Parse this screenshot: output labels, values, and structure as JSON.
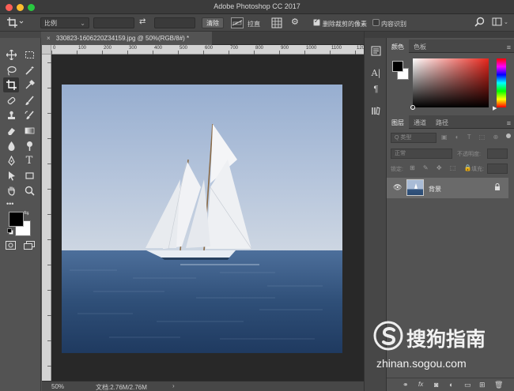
{
  "window": {
    "title": "Adobe Photoshop CC 2017"
  },
  "options_bar": {
    "ratio_label": "比例",
    "clear_label": "清除",
    "straighten_label": "拉直",
    "delete_cropped_label": "删除裁剪的像素",
    "content_aware_label": "内容识别",
    "delete_cropped_checked": true,
    "content_aware_checked": false
  },
  "document": {
    "tab_title": "330823-1606220Z34159.jpg @ 50%(RGB/8#) *",
    "ruler_marks": [
      "0",
      "100",
      "200",
      "300",
      "400",
      "500",
      "600",
      "700",
      "800",
      "900",
      "1000",
      "1100",
      "1200"
    ],
    "zoom": "50%",
    "doc_size": "文档:2.76M/2.76M"
  },
  "color_panel": {
    "tabs": [
      "颜色",
      "色板"
    ],
    "foreground": "#000000",
    "background": "#ffffff",
    "hue_color": "#e8261c"
  },
  "layers_panel": {
    "tabs": [
      "图层",
      "通道",
      "路径"
    ],
    "kind_filter": "Q 类型",
    "blend_mode": "正常",
    "opacity_label": "不透明度:",
    "lock_label": "锁定:",
    "fill_label": "填充:",
    "layer_name": "背景"
  },
  "watermark": {
    "brand": "搜狗指南",
    "url": "zhinan.sogou.com"
  }
}
